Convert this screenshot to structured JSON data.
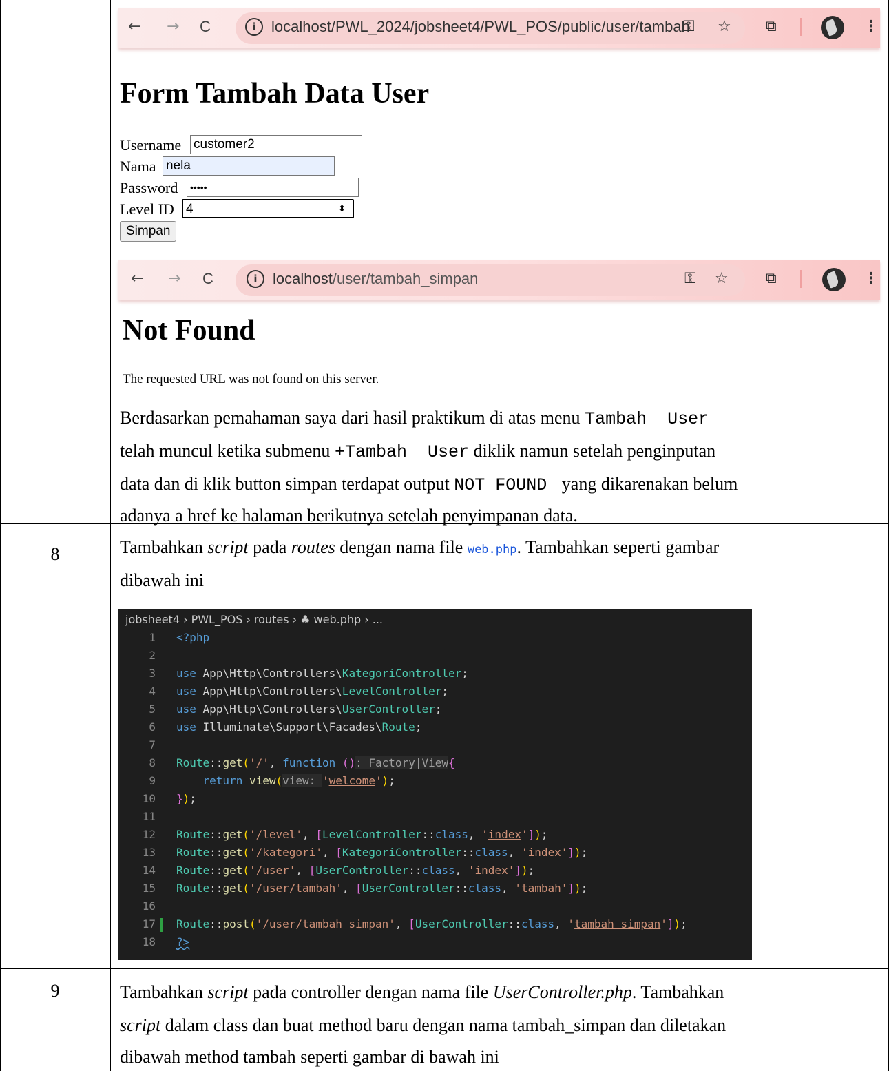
{
  "form_browser": {
    "url_main": "localhost/PWL_2024/jobsheet4/PWL_POS/public/user/tambah",
    "back": "←",
    "forward": "→",
    "reload": "C",
    "info": "i",
    "key": "⚿",
    "star": "☆",
    "ext": "⧉",
    "more": "⋮"
  },
  "form_page": {
    "title": "Form Tambah Data User",
    "username_label": "Username",
    "username_value": "customer2",
    "nama_label": "Nama",
    "nama_value": "nela",
    "password_label": "Password",
    "password_value": "•••••",
    "level_label": "Level ID",
    "level_value": "4",
    "submit_label": "Simpan"
  },
  "error_browser": {
    "url_host": "localhost",
    "url_path": "/user/tambah_simpan"
  },
  "error_page": {
    "title": "Not Found",
    "message": "The requested URL was not found on this server."
  },
  "explanation": {
    "line1_text": "Berdasarkan pemahaman saya dari hasil praktikum di atas menu ",
    "line1_code": "Tambah  User",
    "line2_a": "telah muncul ketika submenu ",
    "line2_code": "+Tambah  User",
    "line2_b": " diklik namun setelah penginputan",
    "line3_a": "data dan di klik button simpan terdapat output ",
    "line3_code": "NOT FOUND ",
    "line3_b": " yang dikarenakan belum",
    "line4": "adanya a href ke halaman berikutnya setelah penyimpanan data."
  },
  "step8": {
    "number": "8",
    "text_a": "Tambahkan ",
    "text_script": "script",
    "text_b": " pada ",
    "text_routes": "routes",
    "text_c": " dengan nama file ",
    "text_file": "web.php",
    "text_d": ". Tambahkan seperti gambar",
    "text_line2": "dibawah ini"
  },
  "editor": {
    "breadcrumb": "jobsheet4 › PWL_POS › routes › ♣ web.php › ...",
    "ln": [
      "1",
      "2",
      "3",
      "4",
      "5",
      "6",
      "7",
      "8",
      "9",
      "10",
      "11",
      "12",
      "13",
      "14",
      "15",
      "16",
      "17",
      "18"
    ]
  },
  "step9": {
    "number": "9",
    "l1_a": "Tambahkan ",
    "l1_script": "script",
    "l1_b": " pada controller dengan nama file ",
    "l1_file": "UserController.php",
    "l1_c": ". Tambahkan",
    "l2_script": "script",
    "l2_b": " dalam class dan buat method baru dengan nama tambah_simpan dan diletakan",
    "l3": "dibawah method tambah seperti gambar di bawah ini"
  }
}
